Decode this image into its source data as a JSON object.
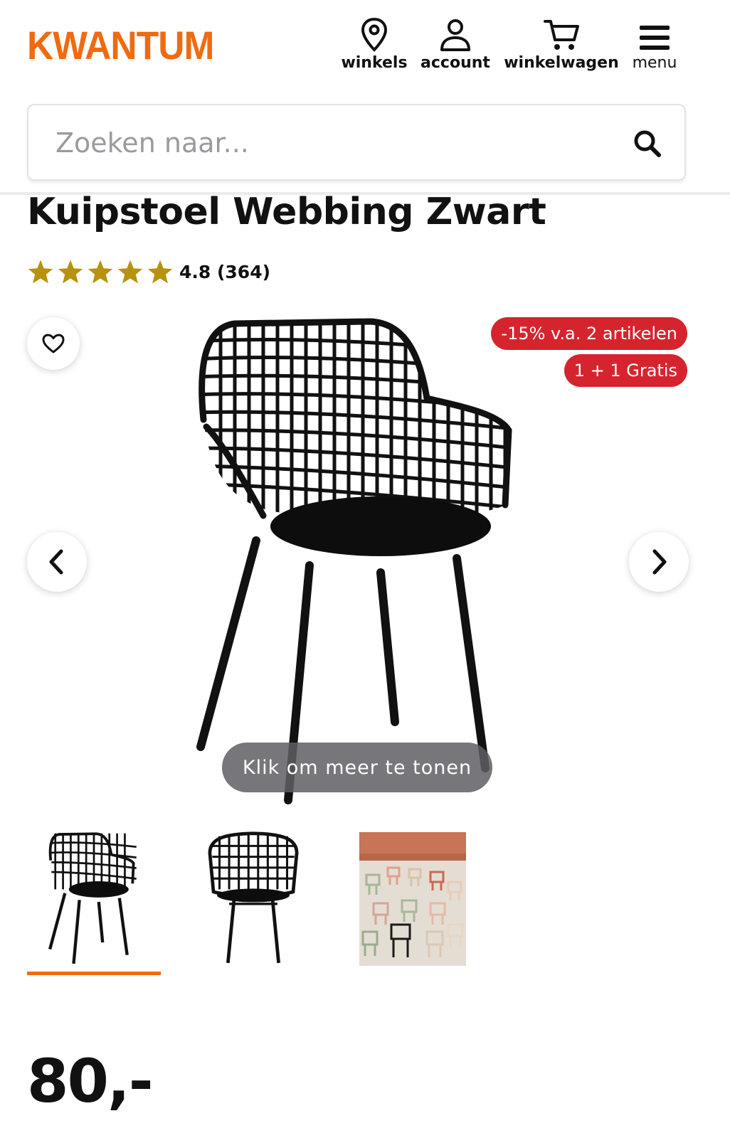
{
  "brand": {
    "name": "KWANTUM",
    "color": "#f06a12"
  },
  "nav": [
    {
      "label": "winkels",
      "icon": "location-pin-icon"
    },
    {
      "label": "account",
      "icon": "user-icon"
    },
    {
      "label": "winkelwagen",
      "icon": "cart-icon"
    },
    {
      "label": "menu",
      "icon": "hamburger-icon"
    }
  ],
  "search": {
    "placeholder": "Zoeken naar...",
    "icon": "search-icon"
  },
  "product": {
    "title": "Kuipstoel Webbing Zwart",
    "rating": {
      "stars": 4.8,
      "score_text": "4.8 (364)",
      "star_color": "#b8920e"
    },
    "badges": [
      "-15% v.a. 2 artikelen",
      "1 + 1 Gratis"
    ],
    "badge_color": "#d6242f",
    "gallery_hint": "Klik om meer te tonen",
    "thumbnails": [
      "chair-front-angle",
      "chair-front",
      "chairs-lifestyle"
    ],
    "active_thumbnail": 0,
    "price": "80,-"
  }
}
